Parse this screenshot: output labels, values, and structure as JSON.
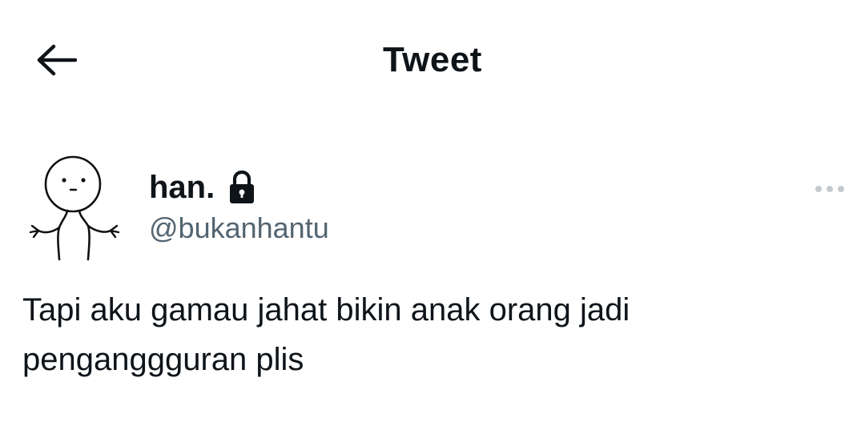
{
  "header": {
    "title": "Tweet",
    "back_icon": "arrow-left-icon"
  },
  "author": {
    "display_name": "han.",
    "handle": "@bukanhantu",
    "protected_icon": "lock-icon",
    "avatar": "shrugging-stick-figure-avatar"
  },
  "more_icon": "more-horizontal-icon",
  "tweet": {
    "text": "Tapi aku gamau jahat bikin anak orang jadi penganggguran plis"
  },
  "colors": {
    "text_primary": "#0f1419",
    "text_secondary": "#536471",
    "more_dots": "#c4c9cd",
    "background": "#ffffff"
  }
}
